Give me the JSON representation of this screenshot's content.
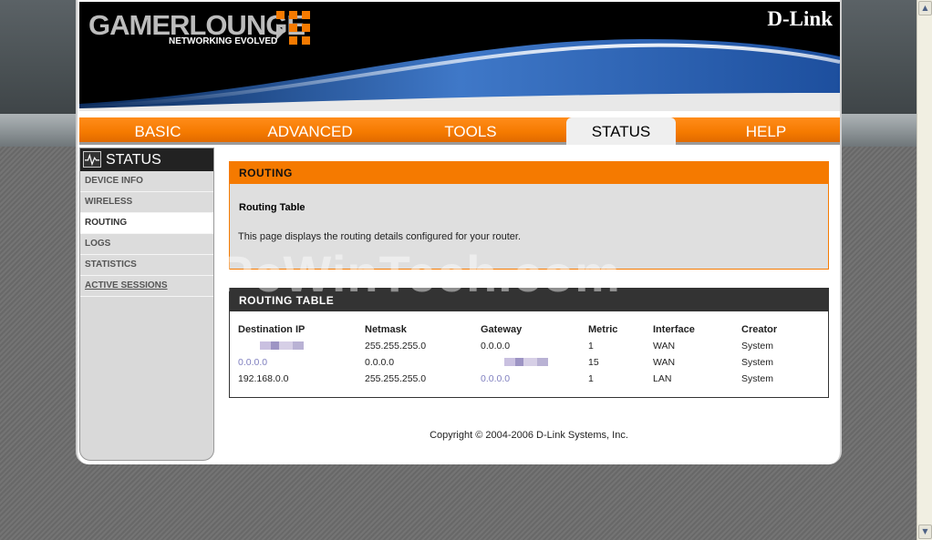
{
  "header": {
    "brand": "GAMERLOUNGE",
    "tagline": "NETWORKING EVOLVED",
    "vendor": "D-Link"
  },
  "nav": {
    "tabs": [
      {
        "label": "BASIC"
      },
      {
        "label": "ADVANCED"
      },
      {
        "label": "TOOLS"
      },
      {
        "label": "STATUS",
        "active": true
      },
      {
        "label": "HELP"
      }
    ]
  },
  "sidebar": {
    "title": "STATUS",
    "items": [
      {
        "label": "DEVICE INFO"
      },
      {
        "label": "WIRELESS"
      },
      {
        "label": "ROUTING",
        "active": true
      },
      {
        "label": "LOGS"
      },
      {
        "label": "STATISTICS"
      },
      {
        "label": "ACTIVE SESSIONS"
      }
    ]
  },
  "routing": {
    "title": "ROUTING",
    "subtitle": "Routing Table",
    "description": "This page displays the routing details configured for your router."
  },
  "routing_table": {
    "title": "ROUTING TABLE",
    "columns": [
      "Destination IP",
      "Netmask",
      "Gateway",
      "Metric",
      "Interface",
      "Creator"
    ],
    "rows": [
      [
        "",
        "255.255.255.0",
        "0.0.0.0",
        "1",
        "WAN",
        "System"
      ],
      [
        "0.0.0.0",
        "0.0.0.0",
        "",
        "15",
        "WAN",
        "System"
      ],
      [
        "192.168.0.0",
        "255.255.255.0",
        "0.0.0.0",
        "1",
        "LAN",
        "System"
      ]
    ]
  },
  "footer": {
    "copyright": "Copyright © 2004-2006 D-Link Systems, Inc."
  },
  "watermark": "PcWinTech.com",
  "colors": {
    "accent": "#f57a00",
    "dark_header": "#333333",
    "panel_bg": "#dfdfdf"
  }
}
